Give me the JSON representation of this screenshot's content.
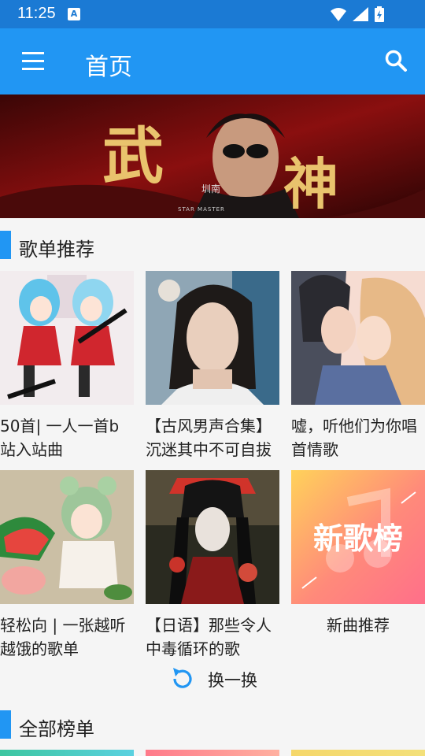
{
  "status": {
    "time": "11:25",
    "notification_letter": "A"
  },
  "appbar": {
    "title": "首页",
    "menu_icon": "menu-icon",
    "search_icon": "search-icon"
  },
  "banner": {
    "text_left": "武",
    "text_right": "神",
    "text_small": "圳南",
    "text_caption": "STAR MASTER"
  },
  "playlist_section": {
    "title": "歌单推荐"
  },
  "playlists": [
    {
      "caption": "50首| 一人一首b站入站曲"
    },
    {
      "caption": "【古风男声合集】沉迷其中不可自拔"
    },
    {
      "caption": "嘘，听他们为你唱首情歌"
    },
    {
      "caption": "轻松向 | 一张越听越饿的歌单"
    },
    {
      "caption": "【日语】那些令人中毒循环的歌"
    },
    {
      "caption": "新曲推荐",
      "cover_text": "新歌榜"
    }
  ],
  "refresh": {
    "label": "换一换"
  },
  "charts_section": {
    "title": "全部榜单"
  },
  "colors": {
    "primary": "#2196f3",
    "statusbar": "#1b7ad4"
  }
}
